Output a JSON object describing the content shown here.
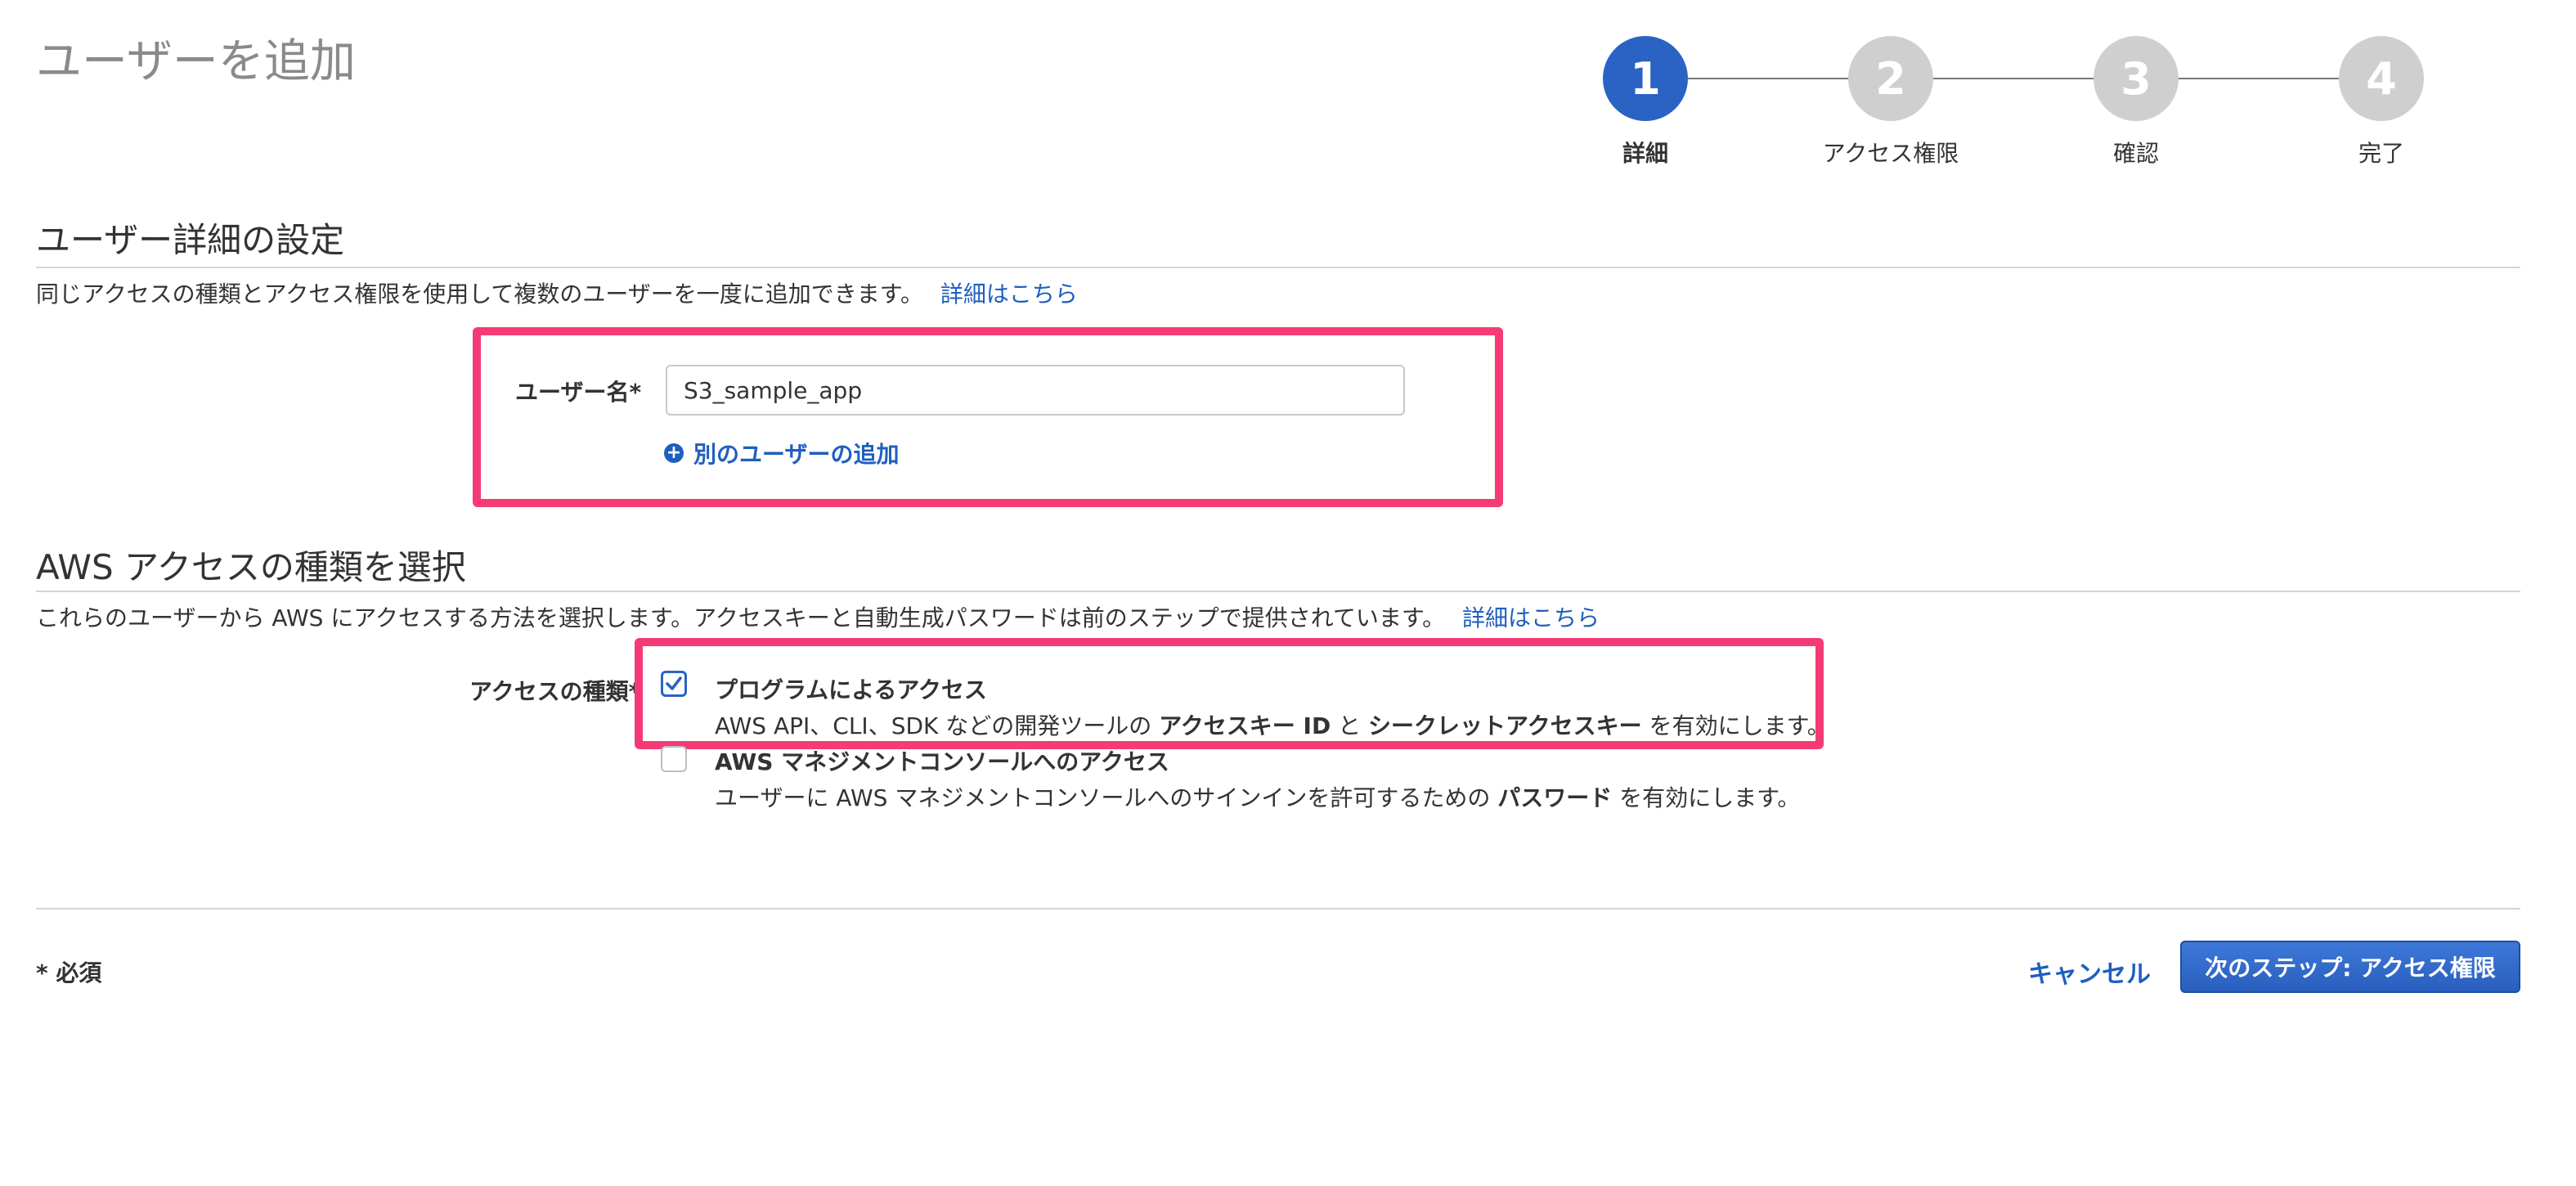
{
  "page": {
    "title": "ユーザーを追加"
  },
  "stepper": {
    "steps": [
      {
        "number": "1",
        "label": "詳細"
      },
      {
        "number": "2",
        "label": "アクセス権限"
      },
      {
        "number": "3",
        "label": "確認"
      },
      {
        "number": "4",
        "label": "完了"
      }
    ],
    "current_step": 1
  },
  "user_details": {
    "heading": "ユーザー詳細の設定",
    "description": "同じアクセスの種類とアクセス権限を使用して複数のユーザーを一度に追加できます。",
    "learn_more": "詳細はこちら",
    "username_label": "ユーザー名*",
    "username_value": "S3_sample_app",
    "add_user_link": "別のユーザーの追加",
    "add_user_icon": "plus-circle-icon"
  },
  "access_type": {
    "heading": "AWS アクセスの種類を選択",
    "description": "これらのユーザーから AWS にアクセスする方法を選択します。アクセスキーと自動生成パスワードは前のステップで提供されています。",
    "learn_more": "詳細はこちら",
    "label": "アクセスの種類*",
    "options": [
      {
        "title": "プログラムによるアクセス",
        "checked": true,
        "desc_1": "AWS API、CLI、SDK などの開発ツールの",
        "desc_bold_1": "アクセスキー ID",
        "desc_2": "と",
        "desc_bold_2": "シークレットアクセスキー",
        "desc_3": "を有効にします。"
      },
      {
        "title": "AWS マネジメントコンソールへのアクセス",
        "checked": false,
        "desc_1": "ユーザーに AWS マネジメントコンソールへのサインインを許可するための",
        "desc_bold_1": "パスワード",
        "desc_2": "を有効にします。"
      }
    ]
  },
  "footer": {
    "required_note": "* 必須",
    "cancel_label": "キャンセル",
    "next_label": "次のステップ: アクセス権限"
  },
  "colors": {
    "accent": "#2a63c4",
    "link": "#1f5fbf",
    "highlight": "#f43b75",
    "inactive_step": "#cfcfcf"
  }
}
